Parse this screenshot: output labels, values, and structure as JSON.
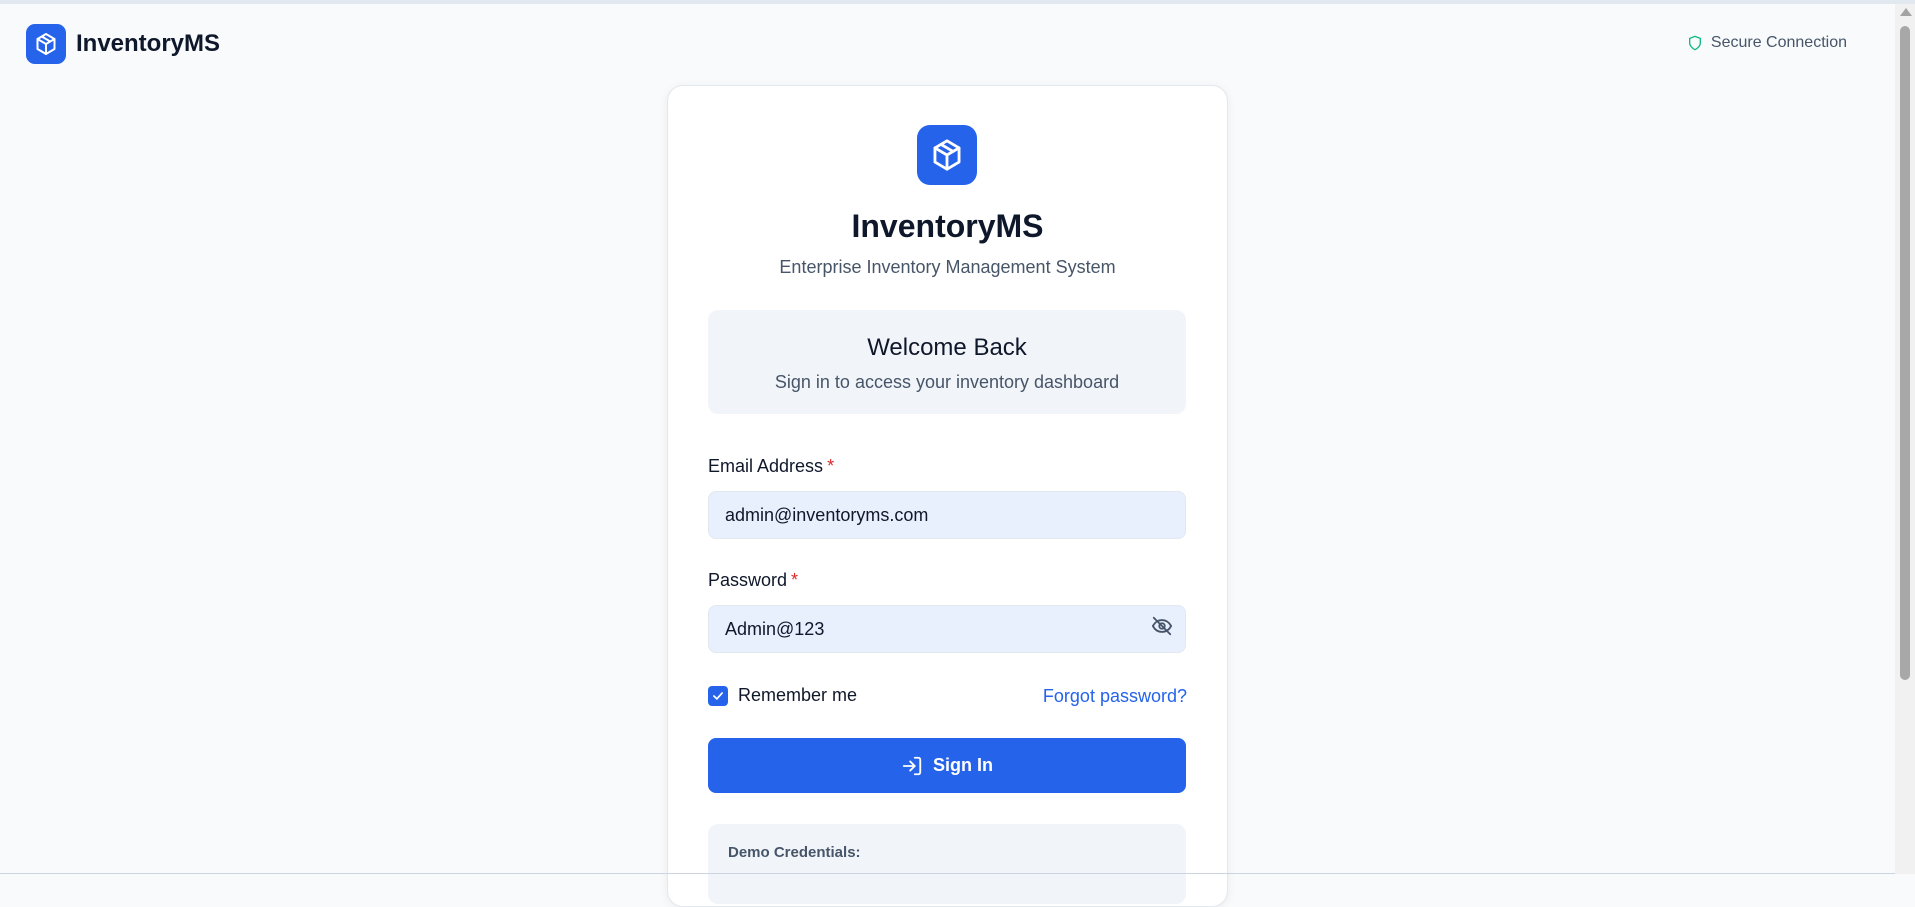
{
  "header": {
    "brand_name": "InventoryMS",
    "secure_text": "Secure Connection"
  },
  "card": {
    "title": "InventoryMS",
    "subtitle": "Enterprise Inventory Management System",
    "welcome_title": "Welcome Back",
    "welcome_subtitle": "Sign in to access your inventory dashboard"
  },
  "form": {
    "email_label": "Email Address",
    "email_value": "admin@inventoryms.com",
    "password_label": "Password",
    "password_value": "Admin@123",
    "required_mark": "*",
    "remember_label": "Remember me",
    "remember_checked": true,
    "forgot_label": "Forgot password?",
    "signin_label": "Sign In"
  },
  "demo": {
    "title": "Demo Credentials:"
  },
  "colors": {
    "primary": "#2563eb",
    "secure_green": "#10b981",
    "required_red": "#dc2626",
    "input_bg": "#e8f0fe"
  },
  "icons": {
    "brand": "package-icon",
    "secure": "shield-icon",
    "password_toggle": "eye-off-icon",
    "checkbox": "check-icon",
    "signin": "log-in-icon"
  }
}
